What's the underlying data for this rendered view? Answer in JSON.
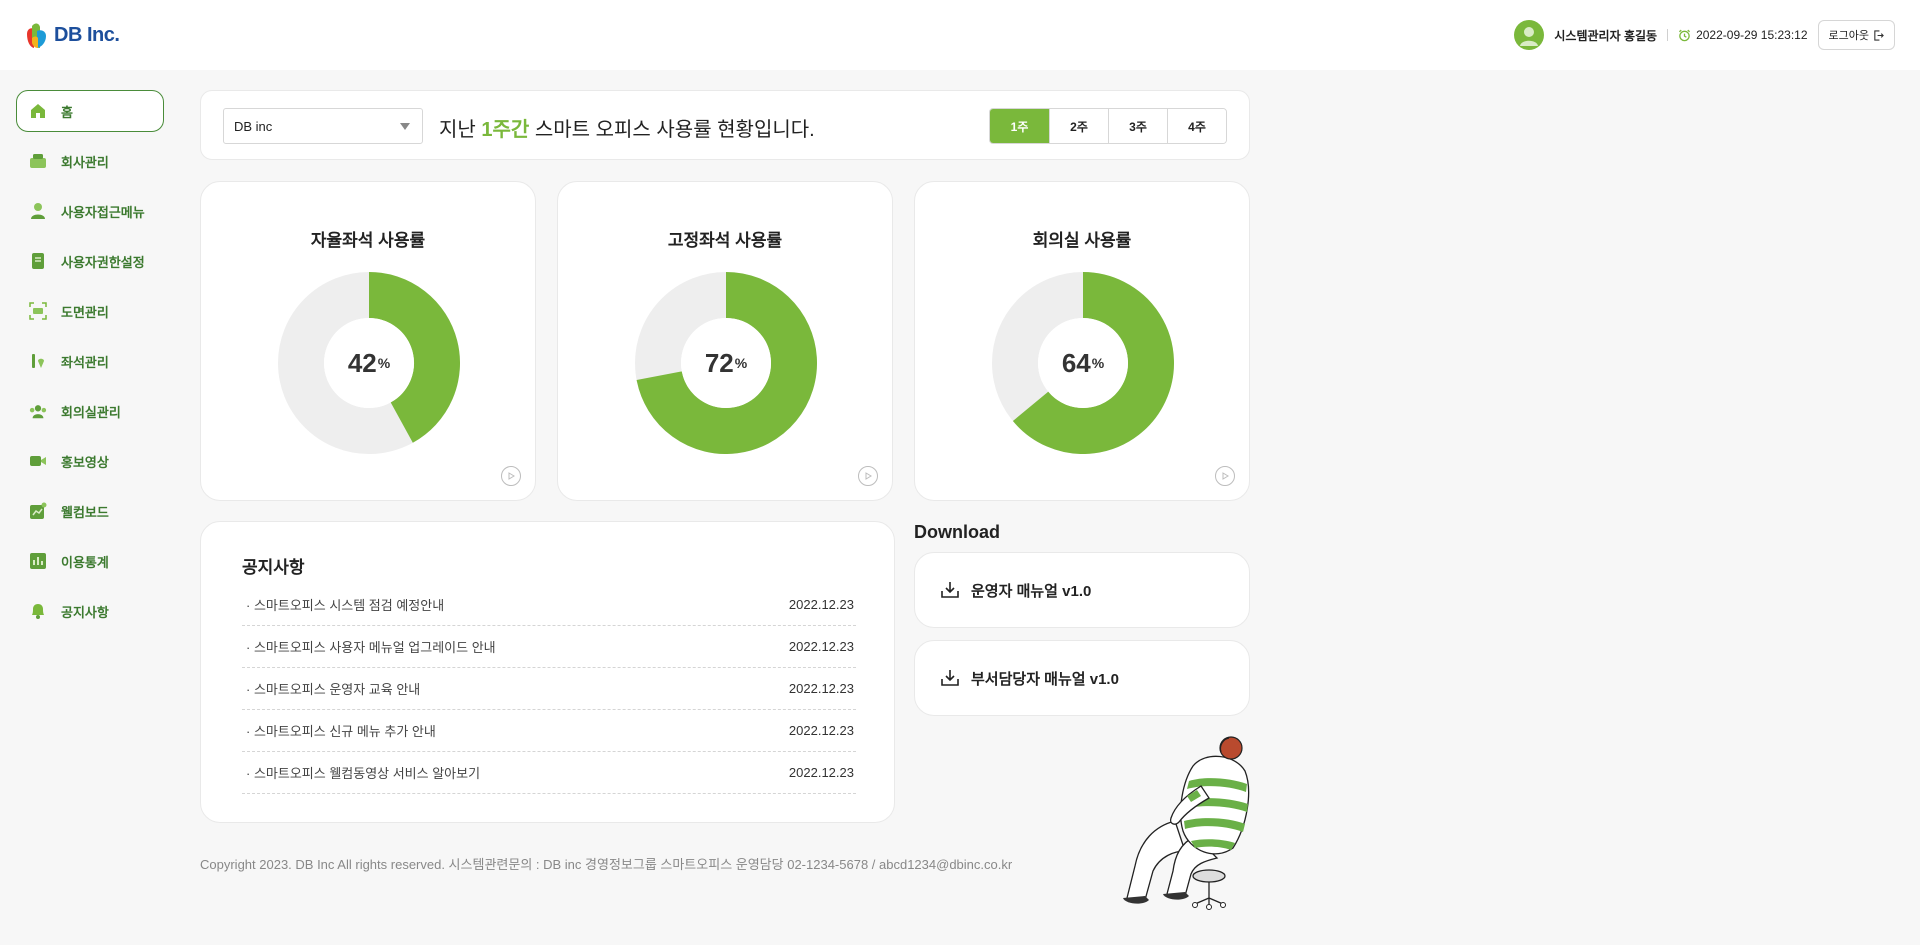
{
  "header": {
    "logo_text": "DB Inc.",
    "user_name": "시스템관리자 홍길동",
    "datetime": "2022-09-29 15:23:12",
    "logout_label": "로그아웃"
  },
  "sidebar": {
    "items": [
      {
        "label": "홈",
        "icon": "home-icon",
        "active": true
      },
      {
        "label": "회사관리",
        "icon": "company-icon"
      },
      {
        "label": "사용자접근메뉴",
        "icon": "user-icon"
      },
      {
        "label": "사용자권한설정",
        "icon": "permission-icon"
      },
      {
        "label": "도면관리",
        "icon": "floorplan-icon"
      },
      {
        "label": "좌석관리",
        "icon": "seat-icon"
      },
      {
        "label": "회의실관리",
        "icon": "meeting-room-icon"
      },
      {
        "label": "홍보영상",
        "icon": "video-icon"
      },
      {
        "label": "웰컴보드",
        "icon": "welcome-board-icon"
      },
      {
        "label": "이용통계",
        "icon": "statistics-icon"
      },
      {
        "label": "공지사항",
        "icon": "bell-icon"
      }
    ]
  },
  "filter": {
    "company": "DB inc",
    "headline_prefix": "지난",
    "headline_highlight": "1주간",
    "headline_suffix": "스마트 오피스 사용률 현황입니다.",
    "weeks": [
      "1주",
      "2주",
      "3주",
      "4주"
    ],
    "selected_week": "1주"
  },
  "usage": [
    {
      "title": "자율좌석 사용률",
      "value": 42,
      "unit": "%"
    },
    {
      "title": "고정좌석 사용률",
      "value": 72,
      "unit": "%"
    },
    {
      "title": "회의실 사용률",
      "value": 64,
      "unit": "%"
    }
  ],
  "notice": {
    "title": "공지사항",
    "items": [
      {
        "text": "· 스마트오피스 시스템 점검 예정안내",
        "date": "2022.12.23"
      },
      {
        "text": "· 스마트오피스 사용자 메뉴얼 업그레이드 안내",
        "date": "2022.12.23"
      },
      {
        "text": "· 스마트오피스 운영자 교육 안내",
        "date": "2022.12.23"
      },
      {
        "text": "· 스마트오피스 신규 메뉴 추가 안내",
        "date": "2022.12.23"
      },
      {
        "text": "· 스마트오피스 웰컴동영상 서비스 알아보기",
        "date": "2022.12.23"
      }
    ]
  },
  "download": {
    "title": "Download",
    "items": [
      {
        "label": "운영자 매뉴얼 v1.0"
      },
      {
        "label": "부서담당자 매뉴얼 v1.0"
      }
    ]
  },
  "footer": {
    "text": "Copyright 2023. DB Inc All rights reserved. 시스템관련문의 : DB inc 경영정보그룹 스마트오피스 운영담당 02-1234-5678 / abcd1234@dbinc.co.kr"
  },
  "colors": {
    "accent": "#7ab83b",
    "nav_text": "#3c7a2f",
    "donut_track": "#eeeeee"
  }
}
